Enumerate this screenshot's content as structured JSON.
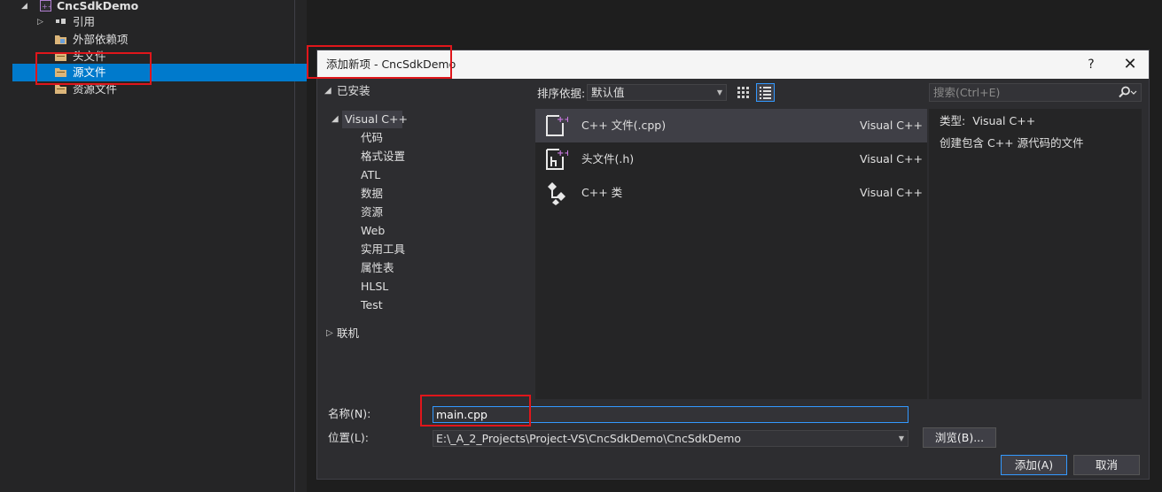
{
  "solution_explorer": {
    "project": "CncSdkDemo",
    "items": [
      {
        "label": "引用"
      },
      {
        "label": "外部依赖项"
      },
      {
        "label": "头文件"
      },
      {
        "label": "源文件"
      },
      {
        "label": "资源文件"
      }
    ]
  },
  "dialog": {
    "title": "添加新项 - CncSdkDemo",
    "help": "?",
    "close": "✕",
    "installed": "已安装",
    "visual_cpp": "Visual C++",
    "categories": [
      "代码",
      "格式设置",
      "ATL",
      "数据",
      "资源",
      "Web",
      "实用工具",
      "属性表",
      "HLSL",
      "Test"
    ],
    "online": "联机",
    "sort_label": "排序依据:",
    "sort_value": "默认值",
    "search_placeholder": "搜索(Ctrl+E)",
    "templates": [
      {
        "name": "C++ 文件(.cpp)",
        "lang": "Visual C++",
        "icon": "cpp-file-icon"
      },
      {
        "name": "头文件(.h)",
        "lang": "Visual C++",
        "icon": "header-file-icon"
      },
      {
        "name": "C++ 类",
        "lang": "Visual C++",
        "icon": "cpp-class-icon"
      }
    ],
    "info_type_label": "类型:",
    "info_type_value": "Visual C++",
    "info_description": "创建包含 C++ 源代码的文件",
    "name_label": "名称(N):",
    "name_value": "main.cpp",
    "location_label": "位置(L):",
    "location_value": "E:\\_A_2_Projects\\Project-VS\\CncSdkDemo\\CncSdkDemo",
    "browse": "浏览(B)...",
    "add": "添加(A)",
    "cancel": "取消"
  },
  "colors": {
    "accent": "#007acc",
    "highlight_box": "#e0161b",
    "folder": "#dcb67a"
  }
}
